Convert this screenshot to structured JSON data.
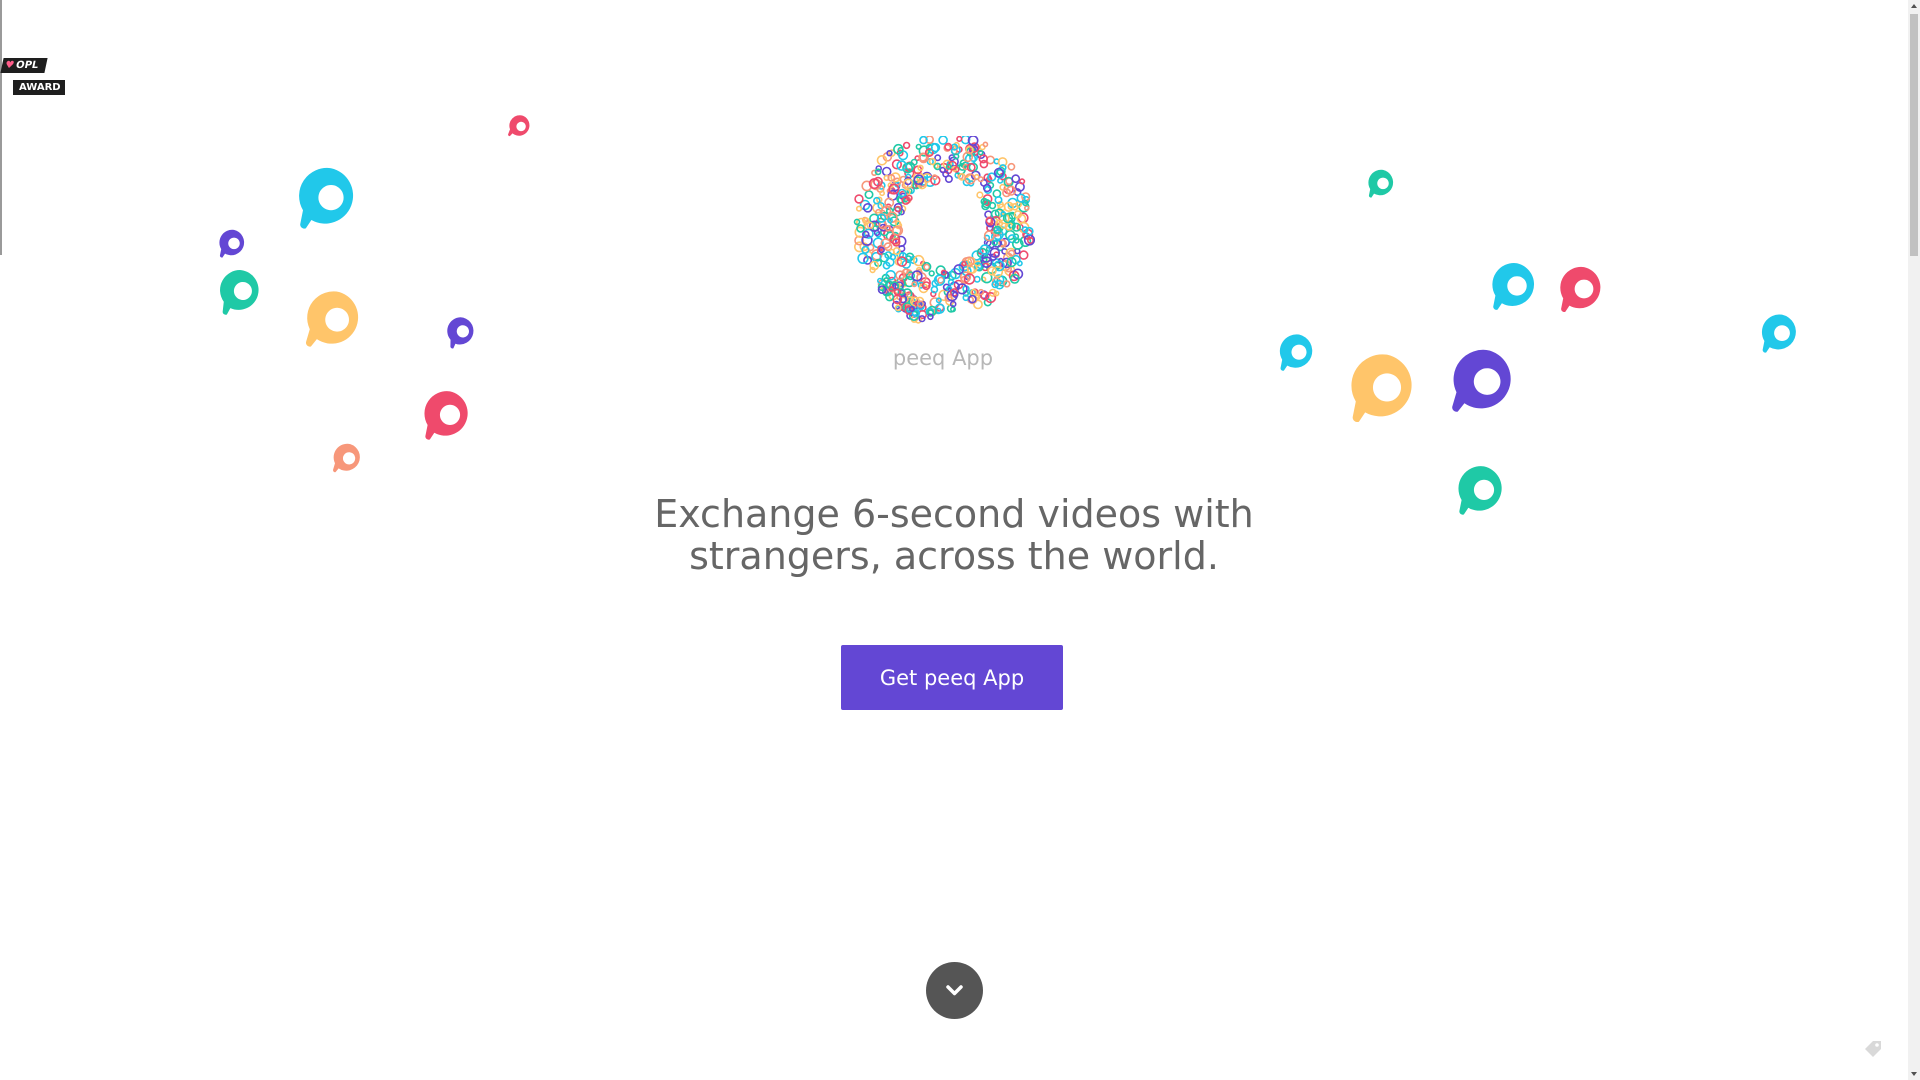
{
  "award": {
    "line1": "OPL",
    "line2": "AWARD",
    "heart": "♥"
  },
  "hero": {
    "logo_icon": "peeq-logo-mosaic",
    "app_name": "peeq App",
    "headline_line1": "Exchange 6-second videos with",
    "headline_line2": "strangers, across the world.",
    "cta_label": "Get peeq App"
  },
  "icons": {
    "scroll_down": "chevron-down-icon",
    "corner": "tag-icon",
    "floating": "peeq-mark-icon"
  },
  "colors": {
    "accent": "#6347d4",
    "cyan": "#21c8ea",
    "teal": "#1fc9a6",
    "yellow": "#ffc56a",
    "purple": "#6347d4",
    "red": "#ef4a6c",
    "salmon": "#f7977a",
    "text": "#666666",
    "muted": "#b7b7b7"
  }
}
